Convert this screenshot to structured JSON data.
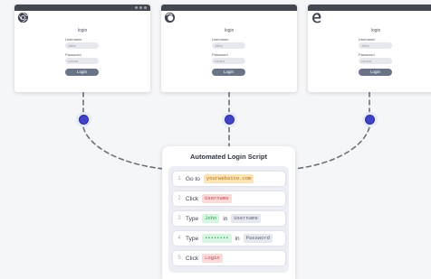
{
  "windows": [
    {
      "browser_icon": "chrome-icon",
      "title": "login",
      "username_label": "Username",
      "username_value": "John",
      "password_label": "Password",
      "password_value": "••••••••",
      "button_label": "Login"
    },
    {
      "browser_icon": "firefox-icon",
      "title": "login",
      "username_label": "Username",
      "username_value": "John",
      "password_label": "Password",
      "password_value": "••••••••",
      "button_label": "Login"
    },
    {
      "browser_icon": "edge-icon",
      "title": "login",
      "username_label": "Username",
      "username_value": "John",
      "password_label": "Password",
      "password_value": "••••••••",
      "button_label": "Login"
    }
  ],
  "script": {
    "title": "Automated Login Script",
    "steps": [
      {
        "num": "1",
        "action": "Go to",
        "arg": "yourwebsite.com"
      },
      {
        "num": "2",
        "action": "Click",
        "arg": "Username"
      },
      {
        "num": "3",
        "action": "Type",
        "arg": "John",
        "joiner": "in",
        "target": "Username"
      },
      {
        "num": "4",
        "action": "Type",
        "arg": "••••••••",
        "joiner": "in",
        "target": "Password"
      },
      {
        "num": "5",
        "action": "Click",
        "arg": "Login"
      }
    ]
  },
  "colors": {
    "node": "#3f43c9",
    "window_bar": "#43474f",
    "login_button": "#6a7388",
    "chip_orange": "#fde4b4",
    "chip_red": "#fbdada",
    "chip_green": "#d7f6e1",
    "chip_gray": "#e5e8ee"
  }
}
